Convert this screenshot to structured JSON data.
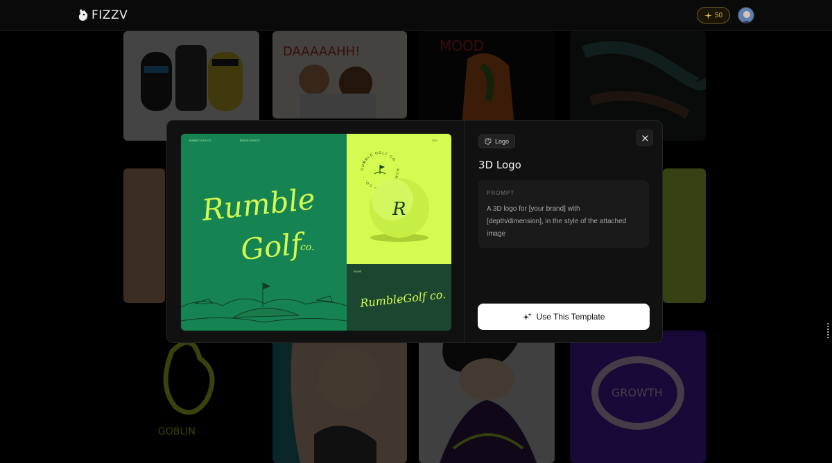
{
  "app": {
    "brand": "FIZZV",
    "credits": "50"
  },
  "modal": {
    "category": "Logo",
    "title": "3D Logo",
    "prompt_label": "PROMPT",
    "prompt_text": "A 3D logo for [your brand] with [depth/dimension], in the style of the attached image",
    "cta_label": "Use This Template",
    "preview": {
      "brand_line_1": "Rumble",
      "brand_line_2": "Golf",
      "brand_suffix": "co.",
      "small_header_left": "RUMBLE GOLF CO.",
      "small_header_center": "BRAND IDENTITY",
      "small_header_right": "2024",
      "ball_monogram": "R",
      "ring_text": "RUMBLE GOLF CO. · RUMBLE GOLF CO. ·",
      "wordmark_caption": "INLINE",
      "wordmark": "RumbleGolf co."
    }
  },
  "colors": {
    "accent_green": "#168452",
    "lime": "#d4fb4f",
    "dark_green": "#1c4630",
    "credits_gold": "#e7c040"
  },
  "icons": {
    "logo": "fizzv-bear-icon",
    "credits": "sparkle-icon",
    "tag": "palette-icon",
    "close": "close-icon",
    "cta": "sparkles-icon"
  }
}
